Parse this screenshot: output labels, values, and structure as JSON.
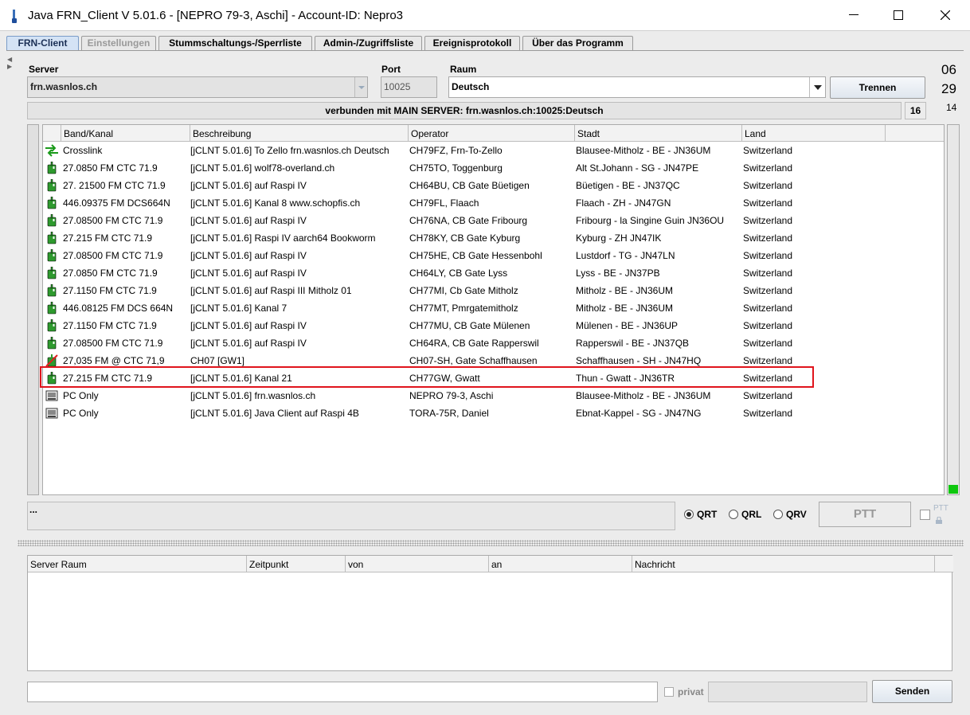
{
  "window": {
    "title": "Java FRN_Client V 5.01.6 - [NEPRO 79-3, Aschi] - Account-ID: Nepro3",
    "minimize": "—",
    "maximize": "☐",
    "close": "✕"
  },
  "tabs": [
    {
      "label": "FRN-Client",
      "state": "active"
    },
    {
      "label": "Einstellungen",
      "state": "disabled"
    },
    {
      "label": "Stummschaltungs-/Sperrliste",
      "state": "normal"
    },
    {
      "label": "Admin-/Zugriffsliste",
      "state": "normal"
    },
    {
      "label": "Ereignisprotokoll",
      "state": "normal"
    },
    {
      "label": "Über das Programm",
      "state": "normal"
    }
  ],
  "connection": {
    "server_label": "Server",
    "server_value": "frn.wasnlos.ch",
    "port_label": "Port",
    "port_value": "10025",
    "room_label": "Raum",
    "room_value": "Deutsch",
    "disconnect_button": "Trennen",
    "status_text": "verbunden mit  MAIN SERVER: frn.wasnlos.ch:10025:Deutsch",
    "user_count": "16"
  },
  "clock": {
    "hours": "06",
    "minutes": "29",
    "seconds": "14"
  },
  "users_table": {
    "columns": [
      "Band/Kanal",
      "Beschreibung",
      "Operator",
      "Stadt",
      "Land"
    ],
    "rows": [
      {
        "icon": "crosslink-icon",
        "band": "Crosslink",
        "desc": "[jCLNT 5.01.6] To Zello frn.wasnlos.ch Deutsch",
        "operator": "CH79FZ, Frn-To-Zello",
        "city": "Blausee-Mitholz - BE - JN36UM",
        "country": "Switzerland"
      },
      {
        "icon": "radio-gateway-icon",
        "band": "27.0850 FM CTC 71.9",
        "desc": "[jCLNT 5.01.6] wolf78-overland.ch",
        "operator": "CH75TO, Toggenburg",
        "city": "Alt St.Johann - SG - JN47PE",
        "country": "Switzerland"
      },
      {
        "icon": "radio-gateway-icon",
        "band": "27. 21500 FM CTC 71.9",
        "desc": "[jCLNT 5.01.6] auf Raspi IV",
        "operator": "CH64BU, CB Gate Büetigen",
        "city": "Büetigen - BE - JN37QC",
        "country": "Switzerland"
      },
      {
        "icon": "radio-gateway-icon",
        "band": "446.09375 FM DCS664N",
        "desc": "[jCLNT 5.01.6] Kanal 8  www.schopfis.ch",
        "operator": "CH79FL, Flaach",
        "city": "Flaach - ZH - JN47GN",
        "country": "Switzerland"
      },
      {
        "icon": "radio-gateway-icon",
        "band": "27.08500 FM CTC 71.9",
        "desc": "[jCLNT 5.01.6] auf Raspi IV",
        "operator": "CH76NA, CB Gate Fribourg",
        "city": "Fribourg - la Singine Guin JN36OU",
        "country": "Switzerland"
      },
      {
        "icon": "radio-gateway-icon",
        "band": "27.215 FM CTC 71.9",
        "desc": "[jCLNT 5.01.6] Raspi IV aarch64 Bookworm",
        "operator": "CH78KY, CB Gate Kyburg",
        "city": "Kyburg - ZH JN47IK",
        "country": "Switzerland"
      },
      {
        "icon": "radio-gateway-icon",
        "band": "27.08500 FM CTC 71.9",
        "desc": "[jCLNT 5.01.6] auf Raspi IV",
        "operator": "CH75HE, CB Gate Hessenbohl",
        "city": "Lustdorf - TG - JN47LN",
        "country": "Switzerland"
      },
      {
        "icon": "radio-gateway-icon",
        "band": "27.0850 FM CTC 71.9",
        "desc": "[jCLNT 5.01.6] auf Raspi IV",
        "operator": "CH64LY, CB Gate Lyss",
        "city": "Lyss - BE - JN37PB",
        "country": "Switzerland"
      },
      {
        "icon": "radio-gateway-icon",
        "band": "27.1150 FM CTC 71.9",
        "desc": "[jCLNT 5.01.6] auf Raspi III  Mitholz 01",
        "operator": "CH77MI, Cb Gate Mitholz",
        "city": "Mitholz - BE - JN36UM",
        "country": "Switzerland"
      },
      {
        "icon": "radio-gateway-icon",
        "band": "446.08125 FM DCS 664N",
        "desc": "[jCLNT 5.01.6] Kanal 7",
        "operator": "CH77MT, Pmrgatemitholz",
        "city": "Mitholz - BE - JN36UM",
        "country": "Switzerland"
      },
      {
        "icon": "radio-gateway-icon",
        "band": "27.1150 FM CTC 71.9",
        "desc": "[jCLNT 5.01.6] auf Raspi IV",
        "operator": "CH77MU, CB Gate Mülenen",
        "city": "Mülenen - BE - JN36UP",
        "country": "Switzerland"
      },
      {
        "icon": "radio-gateway-icon",
        "band": "27.08500 FM CTC 71.9",
        "desc": "[jCLNT 5.01.6] auf Raspi IV",
        "operator": "CH64RA, CB Gate Rapperswil",
        "city": "Rapperswil - BE - JN37QB",
        "country": "Switzerland"
      },
      {
        "icon": "radio-muted-icon",
        "band": "27,035 FM @ CTC 71,9",
        "desc": "CH07 [GW1]",
        "operator": "CH07-SH, Gate Schaffhausen",
        "city": "Schaffhausen - SH - JN47HQ",
        "country": "Switzerland"
      },
      {
        "icon": "radio-gateway-icon",
        "band": "27.215 FM CTC 71.9",
        "desc": "[jCLNT 5.01.6] Kanal 21",
        "operator": "CH77GW, Gwatt",
        "city": "Thun - Gwatt - JN36TR",
        "country": "Switzerland"
      },
      {
        "icon": "pc-only-icon",
        "band": "PC Only",
        "desc": "[jCLNT 5.01.6] frn.wasnlos.ch",
        "operator": "NEPRO 79-3, Aschi",
        "city": "Blausee-Mitholz - BE - JN36UM",
        "country": "Switzerland"
      },
      {
        "icon": "pc-only-icon",
        "band": "PC Only",
        "desc": "[jCLNT 5.01.6] Java Client auf Raspi 4B",
        "operator": "TORA-75R, Daniel",
        "city": "Ebnat-Kappel - SG - JN47NG",
        "country": "Switzerland"
      }
    ],
    "highlighted_row": 13
  },
  "message_line": "...",
  "status_radios": [
    {
      "label": "QRT",
      "selected": true
    },
    {
      "label": "QRL",
      "selected": false
    },
    {
      "label": "QRV",
      "selected": false
    }
  ],
  "ptt": {
    "button": "PTT",
    "checkbox_label": "PTT"
  },
  "chat_table": {
    "columns": [
      "Server Raum",
      "Zeitpunkt",
      "von",
      "an",
      "Nachricht"
    ]
  },
  "chat_input": {
    "value": "",
    "privat_label": "privat",
    "send_button": "Senden"
  },
  "colors": {
    "highlight": "#e0141c",
    "vu_level": "#0ec70e",
    "active_tab": "#d4e3f5"
  }
}
